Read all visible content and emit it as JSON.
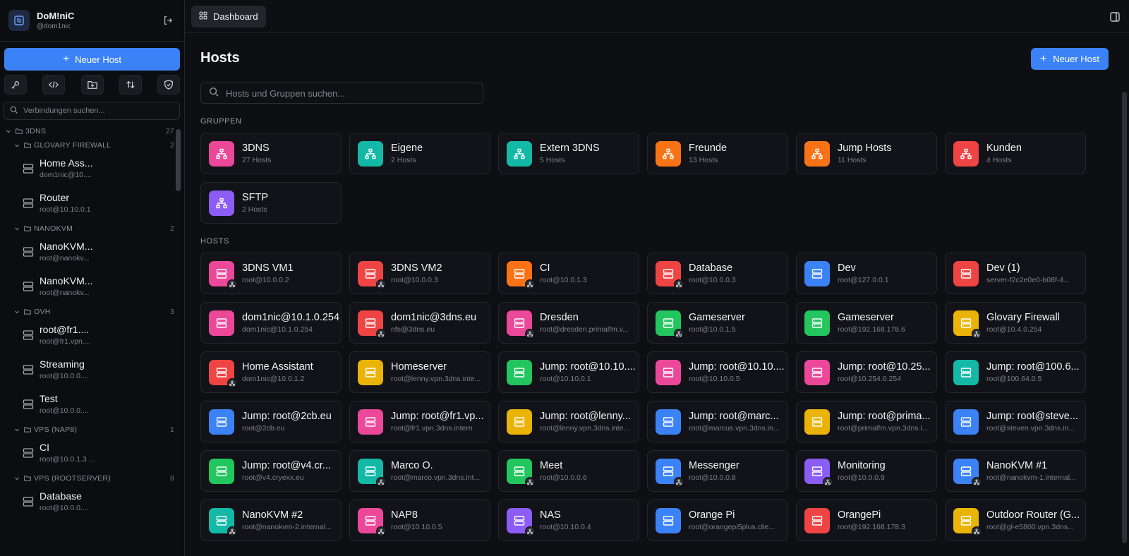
{
  "user": {
    "name": "DoM!niC",
    "handle": "@dom1nic"
  },
  "sidebar": {
    "new_host_label": "Neuer Host",
    "search_placeholder": "Verbindungen suchen...",
    "tools": [
      "key-icon",
      "code-icon",
      "folder-plus-icon",
      "sort-icon",
      "shield-icon"
    ],
    "tree": [
      {
        "type": "group",
        "label": "3DNS",
        "count": "27",
        "level": 0
      },
      {
        "type": "group",
        "label": "GLOVARY FIREWALL",
        "count": "2",
        "level": 1
      },
      {
        "type": "host",
        "name": "Home Ass...",
        "sub": "dom1nic@10...."
      },
      {
        "type": "host",
        "name": "Router",
        "sub": "root@10.10.0.1"
      },
      {
        "type": "group",
        "label": "NANOKVM",
        "count": "2",
        "level": 1
      },
      {
        "type": "host",
        "name": "NanoKVM...",
        "sub": "root@nanokv..."
      },
      {
        "type": "host",
        "name": "NanoKVM...",
        "sub": "root@nanokv..."
      },
      {
        "type": "group",
        "label": "OVH",
        "count": "3",
        "level": 1
      },
      {
        "type": "host",
        "name": "root@fr1....",
        "sub": "root@fr1.vpn...."
      },
      {
        "type": "host",
        "name": "Streaming",
        "sub": "root@10.0.0...."
      },
      {
        "type": "host",
        "name": "Test",
        "sub": "root@10.0.0...."
      },
      {
        "type": "group",
        "label": "VPS (NAP8)",
        "count": "1",
        "level": 1
      },
      {
        "type": "host",
        "name": "CI",
        "sub": "root@10.0.1.3 ..."
      },
      {
        "type": "group",
        "label": "VPS (ROOTSERVER)",
        "count": "8",
        "level": 1
      },
      {
        "type": "host",
        "name": "Database",
        "sub": "root@10.0.0...."
      }
    ]
  },
  "topbar": {
    "tab_label": "Dashboard"
  },
  "main": {
    "title": "Hosts",
    "new_host_label": "Neuer Host",
    "search_placeholder": "Hosts und Gruppen suchen...",
    "groups_label": "GRUPPEN",
    "hosts_label": "HOSTS"
  },
  "colors": {
    "pink": "#ec4899",
    "teal": "#14b8a6",
    "orange": "#f97316",
    "red": "#ef4444",
    "purple": "#8b5cf6",
    "blue": "#3b82f6",
    "yellow": "#eab308",
    "green": "#22c55e"
  },
  "groups": [
    {
      "name": "3DNS",
      "sub": "27 Hosts",
      "color": "pink"
    },
    {
      "name": "Eigene",
      "sub": "2 Hosts",
      "color": "teal"
    },
    {
      "name": "Extern 3DNS",
      "sub": "5 Hosts",
      "color": "teal"
    },
    {
      "name": "Freunde",
      "sub": "13 Hosts",
      "color": "orange"
    },
    {
      "name": "Jump Hosts",
      "sub": "11 Hosts",
      "color": "orange"
    },
    {
      "name": "Kunden",
      "sub": "4 Hosts",
      "color": "red"
    },
    {
      "name": "SFTP",
      "sub": "2 Hosts",
      "color": "purple"
    }
  ],
  "hosts": [
    {
      "name": "3DNS VM1",
      "sub": "root@10.0.0.2",
      "color": "pink",
      "jump": true
    },
    {
      "name": "3DNS VM2",
      "sub": "root@10.0.0.3",
      "color": "red",
      "jump": true
    },
    {
      "name": "CI",
      "sub": "root@10.0.1.3",
      "color": "orange",
      "jump": true
    },
    {
      "name": "Database",
      "sub": "root@10.0.0.3",
      "color": "red",
      "jump": true
    },
    {
      "name": "Dev",
      "sub": "root@127.0.0.1",
      "color": "blue",
      "jump": false
    },
    {
      "name": "Dev (1)",
      "sub": "server-f2c2e0e0-b08f-4...",
      "color": "red",
      "jump": false
    },
    {
      "name": "dom1nic@10.1.0.254",
      "sub": "dom1nic@10.1.0.254",
      "color": "pink",
      "jump": false
    },
    {
      "name": "dom1nic@3dns.eu",
      "sub": "nfs@3dns.eu",
      "color": "red",
      "jump": true
    },
    {
      "name": "Dresden",
      "sub": "root@dresden.primalfm.v...",
      "color": "pink",
      "jump": true
    },
    {
      "name": "Gameserver",
      "sub": "root@10.0.1.5",
      "color": "green",
      "jump": true
    },
    {
      "name": "Gameserver",
      "sub": "root@192.168.178.6",
      "color": "green",
      "jump": false
    },
    {
      "name": "Glovary Firewall",
      "sub": "root@10.4.0.254",
      "color": "yellow",
      "jump": true
    },
    {
      "name": "Home Assistant",
      "sub": "dom1nic@10.0.1.2",
      "color": "red",
      "jump": true
    },
    {
      "name": "Homeserver",
      "sub": "root@lenny.vpn.3dns.inte...",
      "color": "yellow",
      "jump": false
    },
    {
      "name": "Jump: root@10.10....",
      "sub": "root@10.10.0.1",
      "color": "green",
      "jump": false
    },
    {
      "name": "Jump: root@10.10....",
      "sub": "root@10.10.0.5",
      "color": "pink",
      "jump": false
    },
    {
      "name": "Jump: root@10.25...",
      "sub": "root@10.254.0.254",
      "color": "pink",
      "jump": false
    },
    {
      "name": "Jump: root@100.6...",
      "sub": "root@100.64.0.5",
      "color": "teal",
      "jump": false
    },
    {
      "name": "Jump: root@2cb.eu",
      "sub": "root@2cb.eu",
      "color": "blue",
      "jump": false
    },
    {
      "name": "Jump: root@fr1.vp...",
      "sub": "root@fr1.vpn.3dns.intern",
      "color": "pink",
      "jump": false
    },
    {
      "name": "Jump: root@lenny...",
      "sub": "root@lenny.vpn.3dns.inte...",
      "color": "yellow",
      "jump": false
    },
    {
      "name": "Jump: root@marc...",
      "sub": "root@marcus.vpn.3dns.in...",
      "color": "blue",
      "jump": false
    },
    {
      "name": "Jump: root@prima...",
      "sub": "root@primalfm.vpn.3dns.i...",
      "color": "yellow",
      "jump": false
    },
    {
      "name": "Jump: root@steve...",
      "sub": "root@steven.vpn.3dns.in...",
      "color": "blue",
      "jump": false
    },
    {
      "name": "Jump: root@v4.cr...",
      "sub": "root@v4.cryexx.eu",
      "color": "green",
      "jump": false
    },
    {
      "name": "Marco O.",
      "sub": "root@marco.vpn.3dns.int...",
      "color": "teal",
      "jump": true
    },
    {
      "name": "Meet",
      "sub": "root@10.0.0.6",
      "color": "green",
      "jump": true
    },
    {
      "name": "Messenger",
      "sub": "root@10.0.0.8",
      "color": "blue",
      "jump": true
    },
    {
      "name": "Monitoring",
      "sub": "root@10.0.0.9",
      "color": "purple",
      "jump": true
    },
    {
      "name": "NanoKVM #1",
      "sub": "root@nanokvm-1.internal...",
      "color": "blue",
      "jump": true
    },
    {
      "name": "NanoKVM #2",
      "sub": "root@nanokvm-2.internal...",
      "color": "teal",
      "jump": true
    },
    {
      "name": "NAP8",
      "sub": "root@10.10.0.5",
      "color": "pink",
      "jump": true
    },
    {
      "name": "NAS",
      "sub": "root@10.10.0.4",
      "color": "purple",
      "jump": true
    },
    {
      "name": "Orange Pi",
      "sub": "root@orangepi5plus.clie...",
      "color": "blue",
      "jump": false
    },
    {
      "name": "OrangePi",
      "sub": "root@192.168.178.3",
      "color": "red",
      "jump": false
    },
    {
      "name": "Outdoor Router (G...",
      "sub": "root@gl-e5800.vpn.3dns...",
      "color": "yellow",
      "jump": true
    }
  ]
}
